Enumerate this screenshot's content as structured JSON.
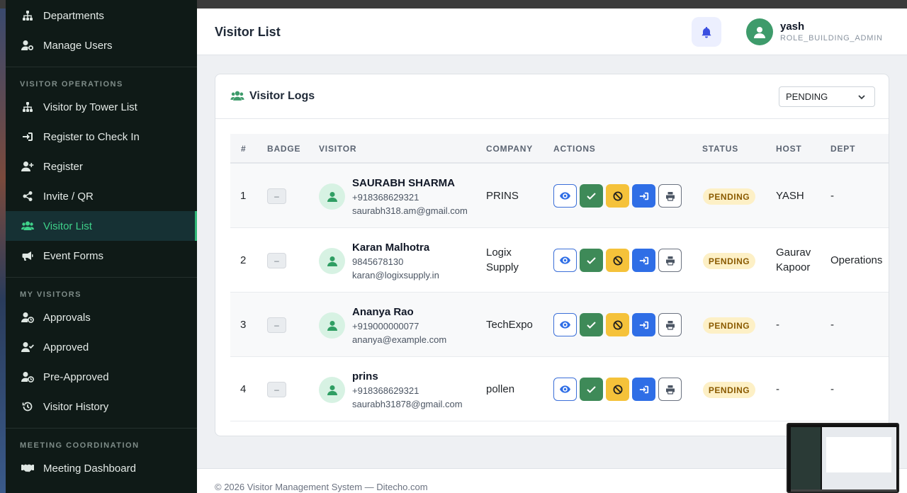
{
  "app": {
    "page_title": "Visitor List",
    "footer": "© 2026 Visitor Management System — Ditecho.com"
  },
  "colors": {
    "accent": "#3fd18a",
    "sidebar_bg": "#0f1a17",
    "status_pending_bg": "#fdf0c6",
    "approve_green": "#3e8a58",
    "reject_yellow": "#f5c23a",
    "checkin_blue": "#2f6ee6"
  },
  "sidebar": {
    "items_top": [
      {
        "label": "Departments",
        "icon": "sitemap-icon"
      },
      {
        "label": "Manage Users",
        "icon": "user-gear-icon"
      }
    ],
    "section_visitor_ops": "VISITOR OPERATIONS",
    "visitor_ops": [
      {
        "label": "Visitor by Tower List",
        "icon": "sitemap-icon"
      },
      {
        "label": "Register to Check In",
        "icon": "sign-in-icon"
      },
      {
        "label": "Register",
        "icon": "user-plus-icon"
      },
      {
        "label": "Invite / QR",
        "icon": "share-icon"
      },
      {
        "label": "Visitor List",
        "icon": "users-icon",
        "active": true
      },
      {
        "label": "Event Forms",
        "icon": "megaphone-icon"
      }
    ],
    "section_my_visitors": "MY VISITORS",
    "my_visitors": [
      {
        "label": "Approvals",
        "icon": "user-clock-icon"
      },
      {
        "label": "Approved",
        "icon": "user-check-icon"
      },
      {
        "label": "Pre-Approved",
        "icon": "user-clock-icon"
      },
      {
        "label": "Visitor History",
        "icon": "history-icon"
      }
    ],
    "section_meeting": "MEETING COORDINATION",
    "meeting": [
      {
        "label": "Meeting Dashboard",
        "icon": "handshake-icon"
      }
    ]
  },
  "header": {
    "user_name": "yash",
    "user_role": "ROLE_BUILDING_ADMIN"
  },
  "card": {
    "title": "Visitor Logs",
    "filter_value": "PENDING"
  },
  "table": {
    "columns": [
      "#",
      "BADGE",
      "VISITOR",
      "COMPANY",
      "ACTIONS",
      "STATUS",
      "HOST",
      "DEPT"
    ],
    "rows": [
      {
        "num": "1",
        "badge": "–",
        "name": "SAURABH SHARMA",
        "phone": "+918368629321",
        "email": "saurabh318.am@gmail.com",
        "company": [
          "PRINS"
        ],
        "status": "PENDING",
        "host": [
          "YASH"
        ],
        "dept": "-"
      },
      {
        "num": "2",
        "badge": "–",
        "name": "Karan Malhotra",
        "phone": "9845678130",
        "email": "karan@logixsupply.in",
        "company": [
          "Logix",
          "Supply"
        ],
        "status": "PENDING",
        "host": [
          "Gaurav",
          "Kapoor"
        ],
        "dept": "Operations"
      },
      {
        "num": "3",
        "badge": "–",
        "name": "Ananya Rao",
        "phone": "+919000000077",
        "email": "ananya@example.com",
        "company": [
          "TechExpo"
        ],
        "status": "PENDING",
        "host": [
          "-"
        ],
        "dept": "-"
      },
      {
        "num": "4",
        "badge": "–",
        "name": "prins",
        "phone": "+918368629321",
        "email": "saurabh31878@gmail.com",
        "company": [
          "pollen"
        ],
        "status": "PENDING",
        "host": [
          "-"
        ],
        "dept": "-"
      }
    ]
  }
}
